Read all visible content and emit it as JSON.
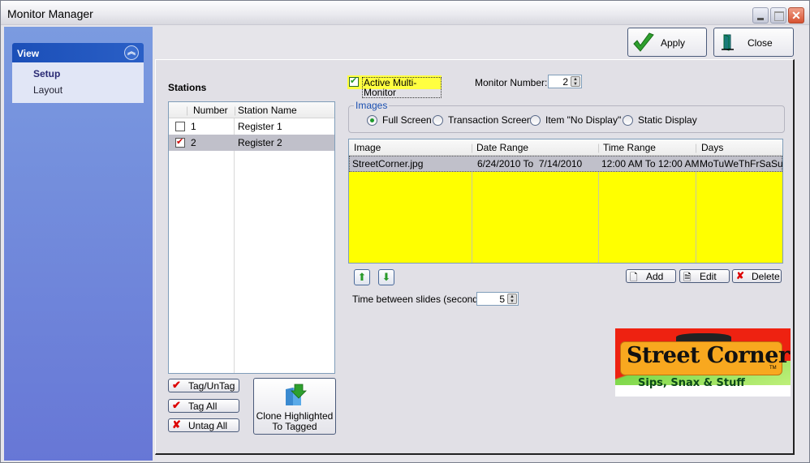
{
  "window": {
    "title": "Monitor Manager",
    "controls": {
      "minimize": "minimize-icon",
      "maximize": "maximize-icon",
      "close": "close-x-icon"
    }
  },
  "sidebar": {
    "section_title": "View",
    "collapse_icon": "double-chevron-up-icon",
    "items": [
      {
        "label": "Setup",
        "selected": true
      },
      {
        "label": "Layout",
        "selected": false
      }
    ]
  },
  "toolbar": {
    "apply_label": "Apply",
    "apply_icon": "green-checkmark-icon",
    "close_label": "Close",
    "close_icon": "door-exit-icon"
  },
  "stations": {
    "title": "Stations",
    "columns": [
      "",
      "Number",
      "Station Name"
    ],
    "rows": [
      {
        "checked": false,
        "number": "1",
        "name": "Register 1",
        "highlighted": false
      },
      {
        "checked": true,
        "number": "2",
        "name": "Register 2",
        "highlighted": true
      }
    ],
    "buttons": {
      "tag_untag": "Tag/UnTag",
      "tag_all": "Tag All",
      "untag_all": "Untag All",
      "clone": "Clone Highlighted To Tagged",
      "clone_line1": "Clone Highlighted",
      "clone_line2": "To Tagged"
    }
  },
  "monitor": {
    "active_multi_monitor_label": "Active Multi-Monitor",
    "active_multi_monitor_checked": true,
    "monitor_number_label": "Monitor Number:",
    "monitor_number_value": "2"
  },
  "images": {
    "group_label": "Images",
    "options": [
      {
        "label": "Full Screen",
        "selected": true
      },
      {
        "label": "Transaction Screen",
        "selected": false
      },
      {
        "label": "Item \"No Display\"",
        "selected": false
      },
      {
        "label": "Static Display",
        "selected": false
      }
    ],
    "table": {
      "columns": [
        "Image",
        "Date Range",
        "Time Range",
        "Days"
      ],
      "rows": [
        {
          "image": "StreetCorner.jpg",
          "date_range": "6/24/2010 To  7/14/2010",
          "time_range": "12:00 AM To 12:00 AM",
          "days": "MoTuWeThFrSaSu"
        }
      ]
    },
    "move_up_icon": "green-arrow-up-icon",
    "move_down_icon": "green-arrow-down-icon",
    "add_label": "Add",
    "edit_label": "Edit",
    "delete_label": "Delete",
    "time_between_label": "Time between slides (seconds):",
    "time_between_value": "5"
  },
  "preview": {
    "title_text": "Street Corner",
    "tagline": "Sips, Snax & Stuff",
    "trademark": "TM"
  },
  "colors": {
    "highlight_yellow": "#ffff00",
    "sidebar_blue": "#6b80d8",
    "view_header_blue": "#1b4fb8",
    "selected_row": "#c0c0ca"
  }
}
